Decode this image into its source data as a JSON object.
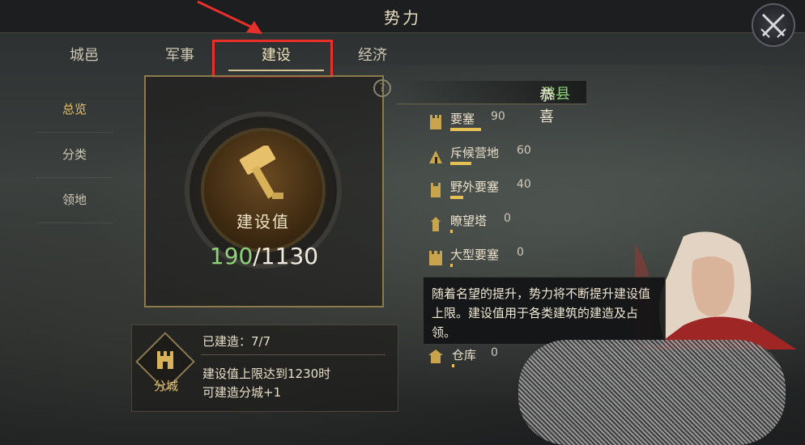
{
  "header": {
    "title": "势力"
  },
  "tabs": [
    {
      "label": "城邑"
    },
    {
      "label": "军事"
    },
    {
      "label": "建设"
    },
    {
      "label": "经济"
    }
  ],
  "sidebar": {
    "items": [
      {
        "label": "总览"
      },
      {
        "label": "分类"
      },
      {
        "label": "领地"
      }
    ]
  },
  "construction": {
    "label": "建设值",
    "current": "190",
    "separator_max": "/1130"
  },
  "congrats": {
    "prefix": "恭喜",
    "county": "潞县"
  },
  "buildings": [
    {
      "name": "要塞",
      "value": "90",
      "progress": 0.9
    },
    {
      "name": "斥候营地",
      "value": "60",
      "progress": 0.6
    },
    {
      "name": "野外要塞",
      "value": "40",
      "progress": 0.4
    },
    {
      "name": "瞭望塔",
      "value": "0",
      "progress": 0.0
    },
    {
      "name": "大型要塞",
      "value": "0",
      "progress": 0.0
    },
    {
      "name": "仓库",
      "value": "0",
      "progress": 0.0
    }
  ],
  "tooltip": {
    "text": "随着名望的提升，势力将不断提升建设值上限。建设值用于各类建筑的建造及占领。"
  },
  "sub_city": {
    "name": "分城",
    "built": "已建造：7/7",
    "desc_line1": "建设值上限达到1230时",
    "desc_line2": "可建造分城+1"
  },
  "colors": {
    "accent": "#e6bf55",
    "highlight_box": "#e8302a",
    "green": "#8fd27a"
  }
}
